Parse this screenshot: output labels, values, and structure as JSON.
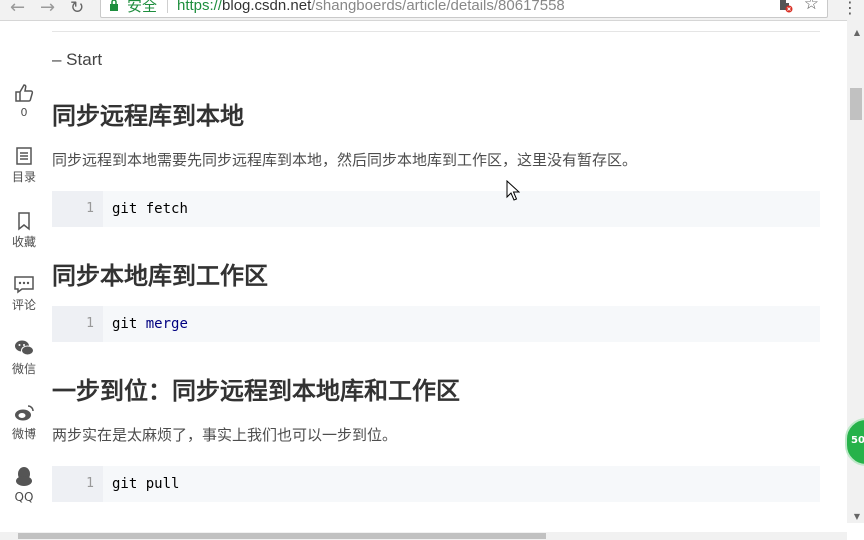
{
  "browser": {
    "secure_label": "安全",
    "url_scheme": "https://",
    "url_host": "blog.csdn.net",
    "url_path": "/shangboerds/article/details/80617558"
  },
  "article": {
    "start": "– Start",
    "sections": [
      {
        "title": "同步远程库到本地",
        "para": "同步远程到本地需要先同步远程库到本地，然后同步本地库到工作区，这里没有暂存区。",
        "code_line": "1",
        "code_cmd": "git",
        "code_arg": "fetch"
      },
      {
        "title": "同步本地库到工作区",
        "code_line": "1",
        "code_cmd": "git",
        "code_arg": "merge"
      },
      {
        "title": "一步到位：同步远程到本地库和工作区",
        "para": "两步实在是太麻烦了，事实上我们也可以一步到位。",
        "code_line": "1",
        "code_cmd": "git",
        "code_arg": "pull"
      }
    ]
  },
  "sidebar": {
    "like_count": "0",
    "toc": "目录",
    "favorite": "收藏",
    "comment": "评论",
    "wechat": "微信",
    "weibo": "微博",
    "qq": "QQ"
  },
  "float_badge": "50"
}
